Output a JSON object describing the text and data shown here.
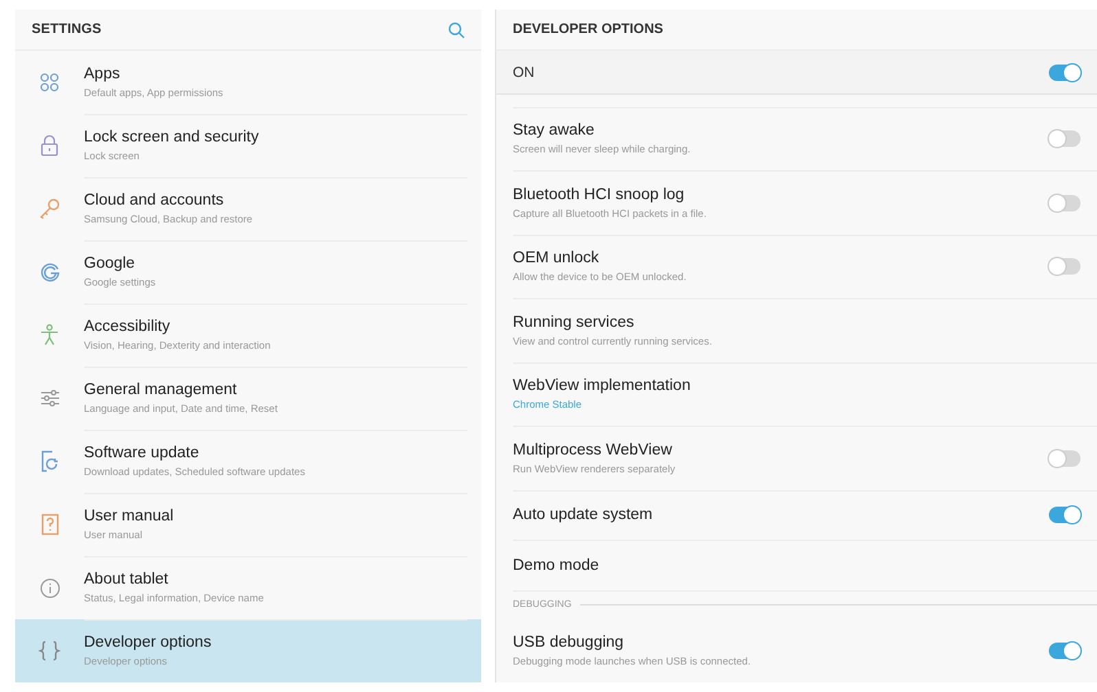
{
  "sidebar": {
    "title": "SETTINGS",
    "items": [
      {
        "title": "Apps",
        "summary": "Default apps, App permissions",
        "selected": false
      },
      {
        "title": "Lock screen and security",
        "summary": "Lock screen",
        "selected": false
      },
      {
        "title": "Cloud and accounts",
        "summary": "Samsung Cloud, Backup and restore",
        "selected": false
      },
      {
        "title": "Google",
        "summary": "Google settings",
        "selected": false
      },
      {
        "title": "Accessibility",
        "summary": "Vision, Hearing, Dexterity and interaction",
        "selected": false
      },
      {
        "title": "General management",
        "summary": "Language and input, Date and time, Reset",
        "selected": false
      },
      {
        "title": "Software update",
        "summary": "Download updates, Scheduled software updates",
        "selected": false
      },
      {
        "title": "User manual",
        "summary": "User manual",
        "selected": false
      },
      {
        "title": "About tablet",
        "summary": "Status, Legal information, Device name",
        "selected": false
      },
      {
        "title": "Developer options",
        "summary": "Developer options",
        "selected": true
      }
    ]
  },
  "detail": {
    "title": "DEVELOPER OPTIONS",
    "master": {
      "label": "ON",
      "on": true
    },
    "rows": [
      {
        "kind": "switch",
        "title": "Stay awake",
        "summary": "Screen will never sleep while charging.",
        "on": false
      },
      {
        "kind": "switch",
        "title": "Bluetooth HCI snoop log",
        "summary": "Capture all Bluetooth HCI packets in a file.",
        "on": false
      },
      {
        "kind": "switch",
        "title": "OEM unlock",
        "summary": "Allow the device to be OEM unlocked.",
        "on": false
      },
      {
        "kind": "plain",
        "title": "Running services",
        "summary": "View and control currently running services."
      },
      {
        "kind": "value",
        "title": "WebView implementation",
        "summary": "Chrome Stable"
      },
      {
        "kind": "switch",
        "title": "Multiprocess WebView",
        "summary": "Run WebView renderers separately",
        "on": false
      },
      {
        "kind": "switch",
        "title": "Auto update system",
        "on": true
      },
      {
        "kind": "plain",
        "title": "Demo mode"
      },
      {
        "kind": "header",
        "title": "DEBUGGING"
      },
      {
        "kind": "switch",
        "title": "USB debugging",
        "summary": "Debugging mode launches when USB is connected.",
        "on": true
      }
    ]
  }
}
